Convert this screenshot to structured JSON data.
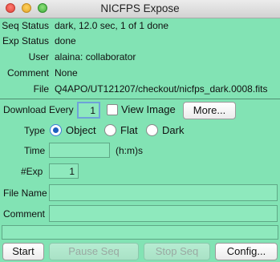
{
  "window": {
    "title": "NICFPS Expose"
  },
  "status": {
    "seq_status_label": "Seq Status",
    "seq_status_value": "dark, 12.0 sec, 1 of 1 done",
    "exp_status_label": "Exp Status",
    "exp_status_value": "done",
    "user_label": "User",
    "user_value": "alaina: collaborator",
    "comment_label": "Comment",
    "comment_value": "None",
    "file_label": "File",
    "file_value": "Q4APO/UT121207/checkout/nicfps_dark.0008.fits"
  },
  "download": {
    "label": "Download",
    "every_label": "Every",
    "every_value": "1",
    "view_image_label": "View Image",
    "view_image_checked": false,
    "more_button": "More..."
  },
  "type": {
    "label": "Type",
    "options": [
      "Object",
      "Flat",
      "Dark"
    ],
    "selected": "Object"
  },
  "time": {
    "label": "Time",
    "value": "",
    "units": "(h:m)s"
  },
  "num_exp": {
    "label": "#Exp",
    "value": "1"
  },
  "file_name": {
    "label": "File Name",
    "value": ""
  },
  "comment_field": {
    "label": "Comment",
    "value": ""
  },
  "status_bar": {
    "text": ""
  },
  "buttons": {
    "start": "Start",
    "pause_seq": "Pause Seq",
    "stop_seq": "Stop Seq",
    "config": "Config..."
  },
  "colors": {
    "background": "#82e3b4",
    "entry": "#8ee9bd"
  }
}
